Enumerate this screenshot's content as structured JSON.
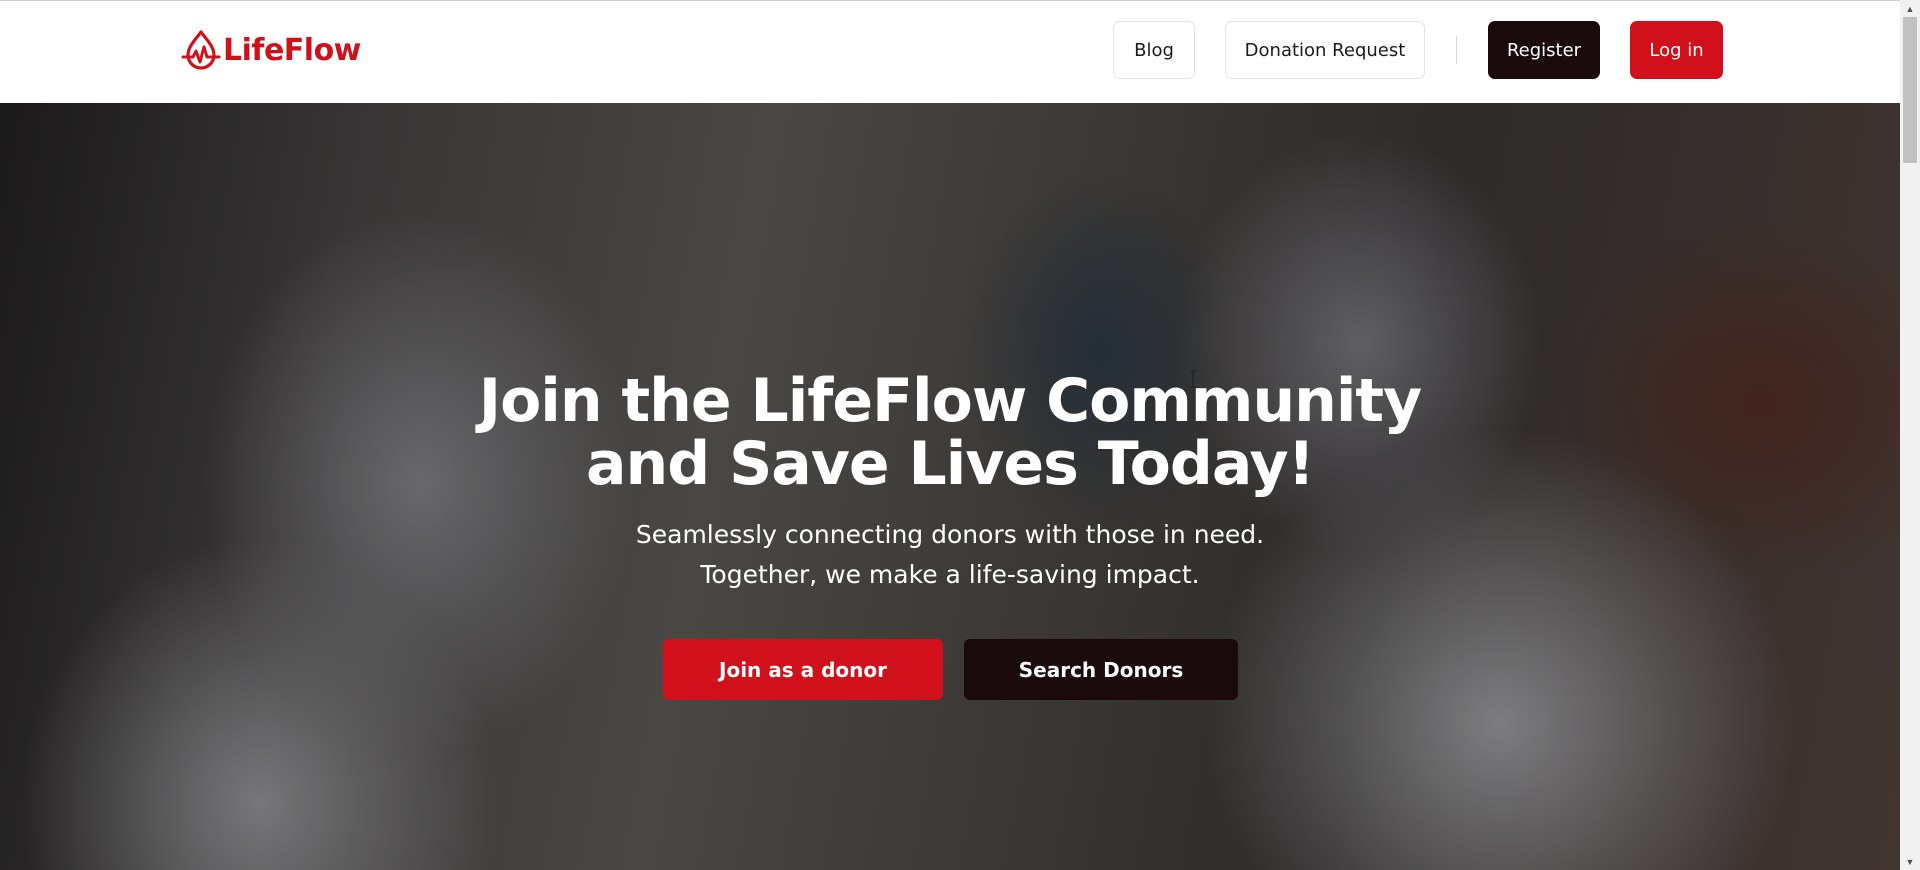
{
  "header": {
    "brand": "LifeFlow",
    "nav": {
      "blog": "Blog",
      "donation_request": "Donation Request",
      "register": "Register",
      "login": "Log in"
    }
  },
  "hero": {
    "headline_line1": "Join the LifeFlow Community",
    "headline_line2": "and Save Lives Today!",
    "subtitle_line1": "Seamlessly connecting donors with those in need.",
    "subtitle_line2": "Together, we make a life-saving impact.",
    "primary_cta": "Join as a donor",
    "secondary_cta": "Search Donors"
  },
  "colors": {
    "brand_red": "#d0111b",
    "dark": "#1a0a0c",
    "white": "#ffffff"
  },
  "icons": {
    "logo": "heartbeat-drop-icon",
    "scroll_up": "triangle-up-icon",
    "scroll_down": "triangle-down-icon"
  }
}
